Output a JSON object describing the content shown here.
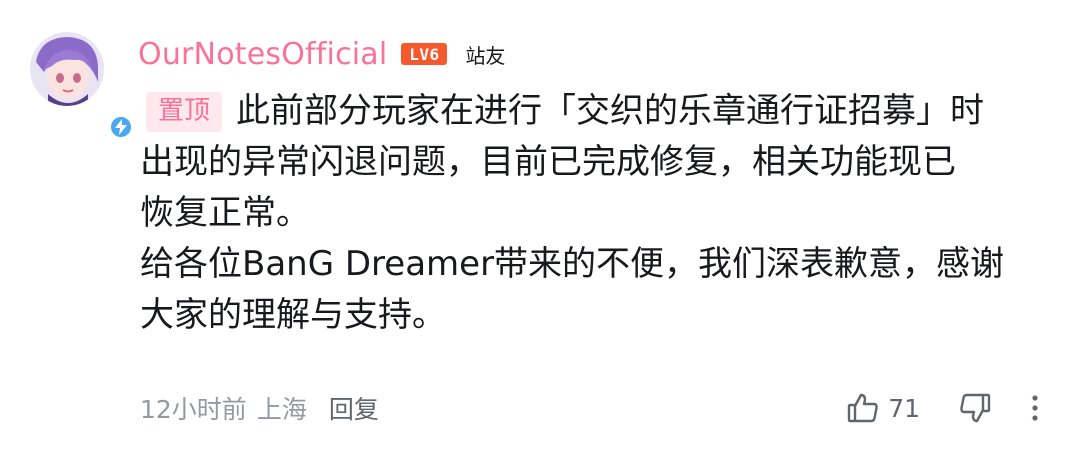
{
  "comment": {
    "username": "OurNotesOfficial",
    "level": "LV6",
    "badge": "站友",
    "pin_label": "置顶",
    "lines": [
      "此前部分玩家在进行「交织的乐章通行证招募」时",
      "出现的异常闪退问题，目前已完成修复，相关功能现已",
      "恢复正常。",
      "给各位BanG Dreamer带来的不便，我们深表歉意，感谢",
      "大家的理解与支持。"
    ],
    "time": "12小时前",
    "location": "上海",
    "reply_label": "回复",
    "like_count": "71"
  },
  "icons": {
    "avatar": "avatar",
    "verify": "lightning-verify-icon",
    "like": "thumbs-up-icon",
    "dislike": "thumbs-down-icon",
    "more": "more-vertical-icon"
  },
  "colors": {
    "username": "#fb7299",
    "level_badge": "#f45a2e",
    "pin_bg": "#ffe9ef",
    "meta": "#9499a0",
    "verify": "#4aa8f0"
  }
}
